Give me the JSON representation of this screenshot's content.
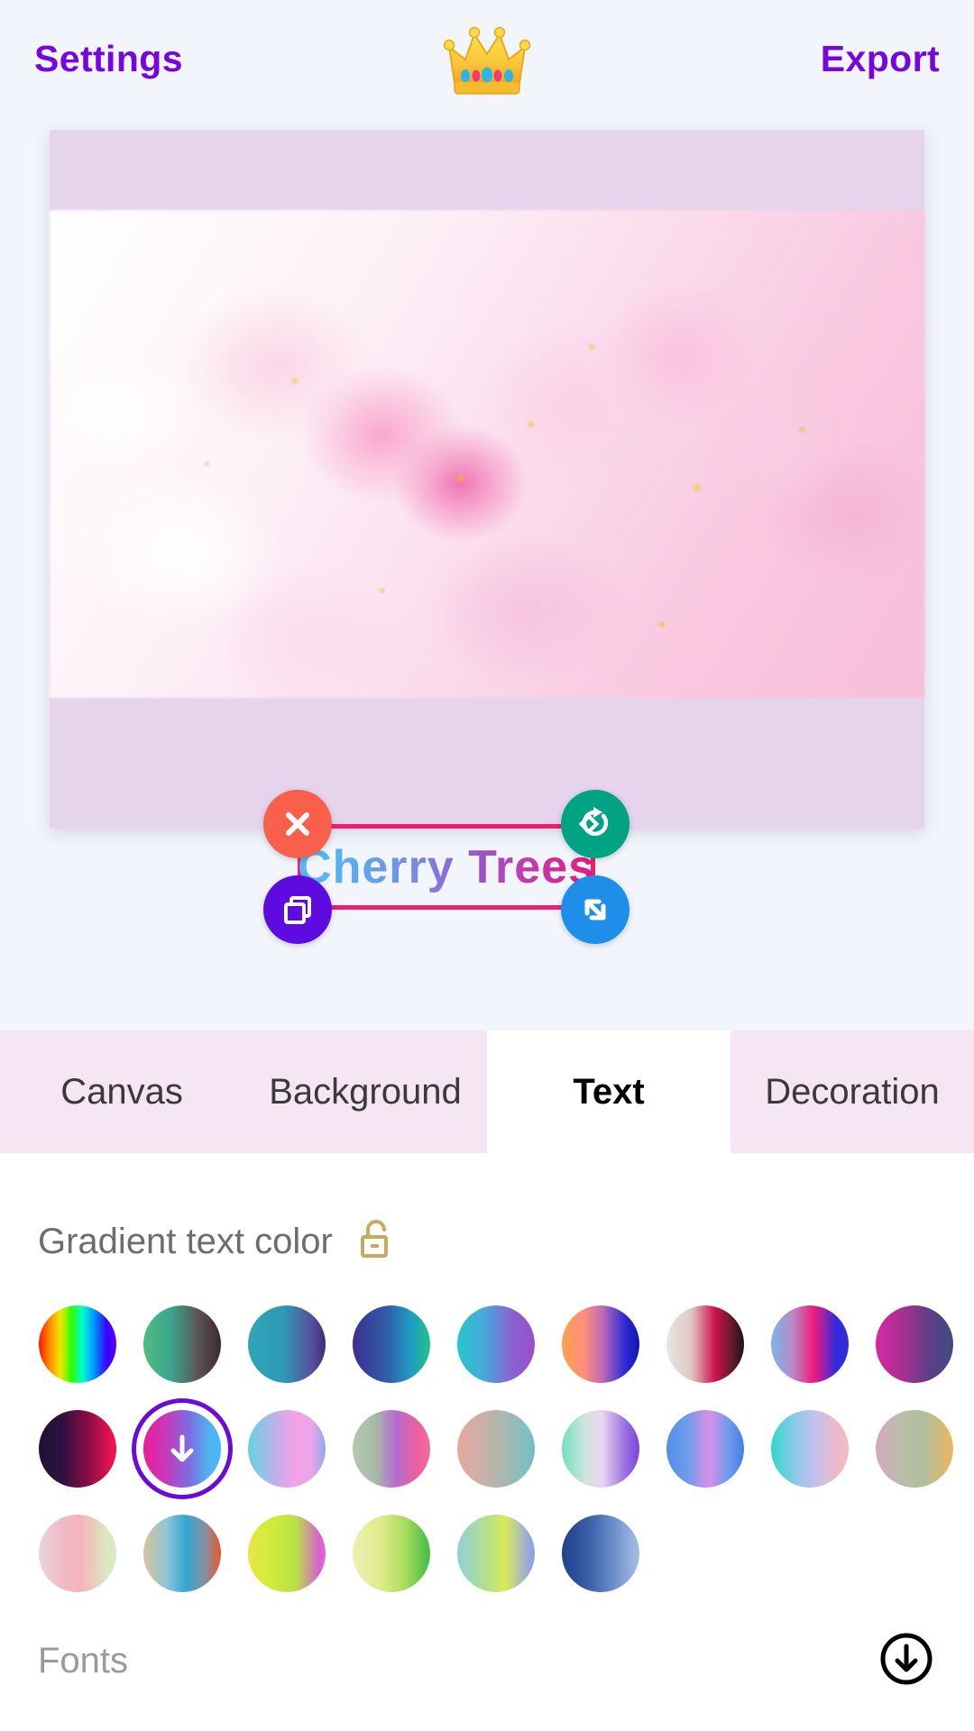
{
  "topbar": {
    "settings_label": "Settings",
    "export_label": "Export",
    "logo_icon": "crown-icon",
    "accent_color": "#7606e0"
  },
  "canvas": {
    "background_color": "#e5d4ec",
    "photo_alt": "cherry-blossom-photo",
    "text_overlay": {
      "value": "Cherry Trees",
      "gradient_start": "#55bcf5",
      "gradient_end": "#e8187f",
      "selection_color": "#ef1e73",
      "handles": [
        {
          "name": "delete-handle",
          "icon": "close-icon",
          "color": "#f9604c"
        },
        {
          "name": "rotate-handle",
          "icon": "rotate-icon",
          "color": "#00a484"
        },
        {
          "name": "duplicate-handle",
          "icon": "copy-icon",
          "color": "#5d0be0"
        },
        {
          "name": "resize-handle",
          "icon": "resize-icon",
          "color": "#1e8fe8"
        }
      ]
    }
  },
  "tabs": [
    {
      "label": "Canvas",
      "active": false
    },
    {
      "label": "Background",
      "active": false
    },
    {
      "label": "Text",
      "active": true
    },
    {
      "label": "Decoration",
      "active": false
    }
  ],
  "panel": {
    "gradient_section": {
      "title": "Gradient text color",
      "lock_icon": "unlock-icon",
      "lock_color": "#c8a95e",
      "selected_index": 10,
      "selected_icon": "download-arrow-icon",
      "selection_ring_color": "#6a0bd8",
      "swatches": [
        {
          "name": "rainbow",
          "css": "linear-gradient(90deg,#ff1500 0%,#ff8a00 14%,#f2e600 28%,#2bff00 42%,#00ffd0 56%,#0090ff 72%,#3a00ff 88%,#5a00ff 100%)"
        },
        {
          "name": "green-brown",
          "css": "linear-gradient(90deg,#4fbf7e 0%,#3ba58e 35%,#5d5558 70%,#3c2830 100%)"
        },
        {
          "name": "teal-purple",
          "css": "linear-gradient(90deg,#2fa6b9 0%,#2e9ab4 45%,#5a4f9e 82%,#3b2f7a 100%)"
        },
        {
          "name": "purple-teal",
          "css": "linear-gradient(90deg,#3b2f8f 0%,#2f5fa8 45%,#1f9bc4 75%,#22c38a 100%)"
        },
        {
          "name": "cyan-violet",
          "css": "linear-gradient(90deg,#22c9c9 0%,#4aa7dd 35%,#8b5fd0 72%,#9a4fc9 100%)"
        },
        {
          "name": "orange-blue",
          "css": "linear-gradient(90deg,#ffa04d 0%,#ff8f7a 28%,#c06bb5 52%,#2a2ad6 82%,#1414b0 100%)"
        },
        {
          "name": "white-crimson",
          "css": "linear-gradient(90deg,#e8e6e0 0%,#e0c8c4 32%,#d01352 62%,#5c1a2a 86%,#221018 100%)"
        },
        {
          "name": "blue-pink-blue",
          "css": "linear-gradient(90deg,#7fb3e8 0%,#b88ac6 28%,#ef1a7c 55%,#2a2ae0 85%,#3d2ad0 100%)"
        },
        {
          "name": "magenta-slate",
          "css": "linear-gradient(90deg,#d926a8 0%,#a8308f 35%,#5a3f86 72%,#3e4f80 100%)"
        },
        {
          "name": "dark-crimson",
          "css": "linear-gradient(90deg,#221333 0%,#2c1140 30%,#8e0c46 65%,#e6134f 92%,#f0144e 100%)"
        },
        {
          "name": "magenta-blue",
          "css": "linear-gradient(90deg,#ef1b96 0%,#c43bbd 30%,#7f6ae0 58%,#4fb3f0 85%,#3fbbf5 100%)"
        },
        {
          "name": "cyan-pink",
          "css": "linear-gradient(90deg,#63d3e0 0%,#b2b6ec 30%,#f2a0e8 58%,#e9a7e8 82%,#8fa8ee 100%)"
        },
        {
          "name": "sage-pink",
          "css": "linear-gradient(90deg,#b4c9ae 0%,#a8bba8 28%,#b46cd0 56%,#ef5f9a 85%,#f06ba0 100%)"
        },
        {
          "name": "rose-sage",
          "css": "linear-gradient(90deg,#e8a79c 0%,#cbb0a8 30%,#a8b8b0 62%,#7fbfc0 90%,#6fbcc2 100%)"
        },
        {
          "name": "mint-violet",
          "css": "linear-gradient(90deg,#6fe0be 0%,#cfe4dd 30%,#e8d6f0 52%,#9a6fe0 82%,#7a44d8 100%)"
        },
        {
          "name": "blue-orchid",
          "css": "linear-gradient(90deg,#4f8fe8 0%,#6f9cec 28%,#d98fe8 55%,#6f9cec 80%,#3f7fe0 100%)"
        },
        {
          "name": "aqua-blush",
          "css": "linear-gradient(90deg,#2fd8cc 0%,#8fc8e8 32%,#c8c0ec 58%,#f0b8c4 88%,#f2bcc6 100%)"
        },
        {
          "name": "mauve-sand",
          "css": "linear-gradient(90deg,#d4a8c0 0%,#b8bfa8 35%,#aebfa0 60%,#e0b868 92%,#e4bc6a 100%)"
        },
        {
          "name": "blush-mint",
          "css": "linear-gradient(90deg,#e8d6e0 0%,#f0b8c4 32%,#f4b4bc 55%,#dce8c0 88%,#d6ecc4 100%)"
        },
        {
          "name": "sand-cyan-rust",
          "css": "linear-gradient(90deg,#d8c49a 0%,#8fc4d8 30%,#2fa8d0 55%,#8a8ea0 80%,#e8562a 100%)"
        },
        {
          "name": "lime-orchid",
          "css": "linear-gradient(90deg,#e8e840 0%,#ccea3c 38%,#b8e048 62%,#d85fd0 92%,#e06ad8 100%)"
        },
        {
          "name": "cream-green",
          "css": "linear-gradient(90deg,#eef0b4 0%,#e0ec8a 35%,#a8dc5c 68%,#4fc04a 95%,#46bc46 100%)"
        },
        {
          "name": "teal-lime-blue",
          "css": "linear-gradient(90deg,#8fd0d8 0%,#b4e08c 38%,#d8ea58 62%,#9aa8e0 92%,#8f9ee0 100%)"
        },
        {
          "name": "navy-sky",
          "css": "linear-gradient(90deg,#1f3f8a 0%,#3a5fa8 35%,#6f90cc 68%,#9ab4e0 92%,#a4bce4 100%)"
        }
      ]
    },
    "fonts_section": {
      "title": "Fonts",
      "download_icon": "cloud-download-icon"
    }
  }
}
